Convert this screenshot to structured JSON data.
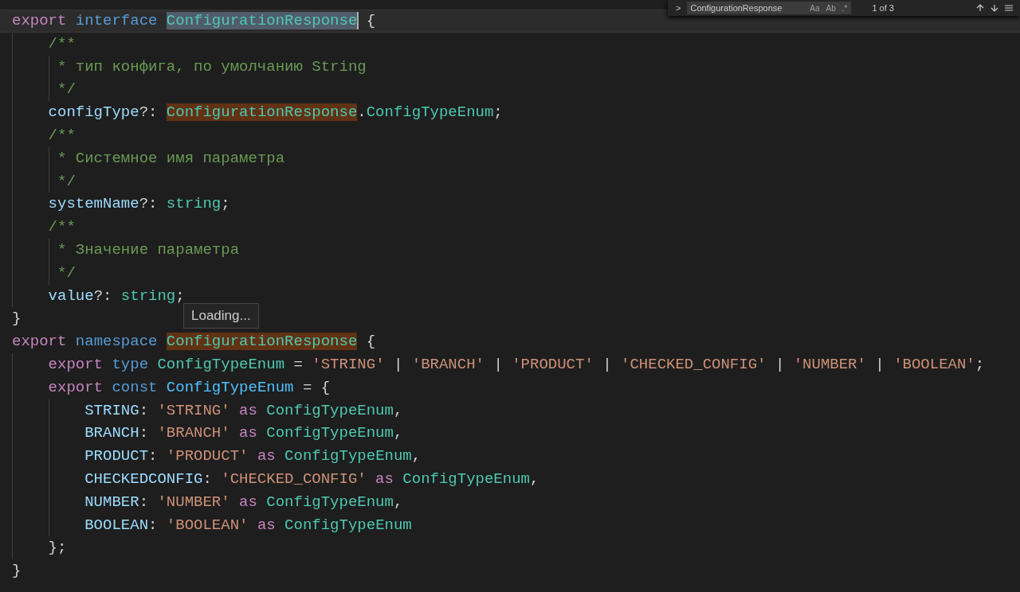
{
  "find_widget": {
    "toggle": ">",
    "query": "ConfigurationResponse",
    "options": [
      {
        "label": "Aa",
        "on": false
      },
      {
        "label": "Ab",
        "on": false
      },
      {
        "label": ".*",
        "on": false
      }
    ],
    "count": "1 of 3"
  },
  "editor": {
    "lines": [
      {
        "current": true,
        "tokens": [
          {
            "kind": "keyword",
            "t": "export"
          },
          {
            "kind": "storage",
            "t": " interface"
          },
          {
            "kind": "type",
            "t": " ConfigurationResponse",
            "match": true,
            "active": true,
            "cursor": true
          },
          {
            "kind": "punct",
            "t": " {"
          }
        ]
      },
      {
        "tokens": [
          {
            "kind": "comment",
            "t": "    /**"
          }
        ]
      },
      {
        "tokens": [
          {
            "kind": "comment",
            "t": "     * тип конфига, по умолчанию String"
          }
        ]
      },
      {
        "tokens": [
          {
            "kind": "comment",
            "t": "     */"
          }
        ]
      },
      {
        "tokens": [
          {
            "kind": "property",
            "t": "    configType"
          },
          {
            "kind": "punct",
            "t": "?:"
          },
          {
            "kind": "type",
            "t": " ConfigurationResponse",
            "match": true,
            "active": false
          },
          {
            "kind": "punct",
            "t": "."
          },
          {
            "kind": "type",
            "t": "ConfigTypeEnum"
          },
          {
            "kind": "punct",
            "t": ";"
          }
        ]
      },
      {
        "tokens": [
          {
            "kind": "comment",
            "t": "    /**"
          }
        ]
      },
      {
        "tokens": [
          {
            "kind": "comment",
            "t": "     * Системное имя параметра"
          }
        ]
      },
      {
        "tokens": [
          {
            "kind": "comment",
            "t": "     */"
          }
        ]
      },
      {
        "tokens": [
          {
            "kind": "property",
            "t": "    systemName"
          },
          {
            "kind": "punct",
            "t": "?:"
          },
          {
            "kind": "type",
            "t": " string"
          },
          {
            "kind": "punct",
            "t": ";"
          }
        ]
      },
      {
        "tokens": [
          {
            "kind": "comment",
            "t": "    /**"
          }
        ]
      },
      {
        "tokens": [
          {
            "kind": "comment",
            "t": "     * Значение параметра"
          }
        ]
      },
      {
        "tokens": [
          {
            "kind": "comment",
            "t": "     */"
          }
        ]
      },
      {
        "tokens": [
          {
            "kind": "property",
            "t": "    value"
          },
          {
            "kind": "punct",
            "t": "?:"
          },
          {
            "kind": "type",
            "t": " string"
          },
          {
            "kind": "punct",
            "t": ";"
          }
        ]
      },
      {
        "tokens": [
          {
            "kind": "punct",
            "t": "}"
          }
        ]
      },
      {
        "tokens": [
          {
            "kind": "keyword",
            "t": "export"
          },
          {
            "kind": "storage",
            "t": " namespace"
          },
          {
            "kind": "type",
            "t": " ConfigurationResponse",
            "match": true,
            "active": false
          },
          {
            "kind": "punct",
            "t": " {"
          }
        ]
      },
      {
        "tokens": [
          {
            "kind": "keyword",
            "t": "    export"
          },
          {
            "kind": "storage",
            "t": " type"
          },
          {
            "kind": "type",
            "t": " ConfigTypeEnum"
          },
          {
            "kind": "punct",
            "t": " ="
          },
          {
            "kind": "string",
            "t": " 'STRING'"
          },
          {
            "kind": "punct",
            "t": " |"
          },
          {
            "kind": "string",
            "t": " 'BRANCH'"
          },
          {
            "kind": "punct",
            "t": " |"
          },
          {
            "kind": "string",
            "t": " 'PRODUCT'"
          },
          {
            "kind": "punct",
            "t": " |"
          },
          {
            "kind": "string",
            "t": " 'CHECKED_CONFIG'"
          },
          {
            "kind": "punct",
            "t": " |"
          },
          {
            "kind": "string",
            "t": " 'NUMBER'"
          },
          {
            "kind": "punct",
            "t": " |"
          },
          {
            "kind": "string",
            "t": " 'BOOLEAN'"
          },
          {
            "kind": "punct",
            "t": ";"
          }
        ]
      },
      {
        "tokens": [
          {
            "kind": "keyword",
            "t": "    export"
          },
          {
            "kind": "storage",
            "t": " const"
          },
          {
            "kind": "const",
            "t": " ConfigTypeEnum"
          },
          {
            "kind": "punct",
            "t": " = {"
          }
        ]
      },
      {
        "tokens": [
          {
            "kind": "property",
            "t": "        STRING"
          },
          {
            "kind": "punct",
            "t": ":"
          },
          {
            "kind": "string",
            "t": " 'STRING'"
          },
          {
            "kind": "keyword",
            "t": " as"
          },
          {
            "kind": "type",
            "t": " ConfigTypeEnum"
          },
          {
            "kind": "punct",
            "t": ","
          }
        ]
      },
      {
        "tokens": [
          {
            "kind": "property",
            "t": "        BRANCH"
          },
          {
            "kind": "punct",
            "t": ":"
          },
          {
            "kind": "string",
            "t": " 'BRANCH'"
          },
          {
            "kind": "keyword",
            "t": " as"
          },
          {
            "kind": "type",
            "t": " ConfigTypeEnum"
          },
          {
            "kind": "punct",
            "t": ","
          }
        ]
      },
      {
        "tokens": [
          {
            "kind": "property",
            "t": "        PRODUCT"
          },
          {
            "kind": "punct",
            "t": ":"
          },
          {
            "kind": "string",
            "t": " 'PRODUCT'"
          },
          {
            "kind": "keyword",
            "t": " as"
          },
          {
            "kind": "type",
            "t": " ConfigTypeEnum"
          },
          {
            "kind": "punct",
            "t": ","
          }
        ]
      },
      {
        "tokens": [
          {
            "kind": "property",
            "t": "        CHECKEDCONFIG"
          },
          {
            "kind": "punct",
            "t": ":"
          },
          {
            "kind": "string",
            "t": " 'CHECKED_CONFIG'"
          },
          {
            "kind": "keyword",
            "t": " as"
          },
          {
            "kind": "type",
            "t": " ConfigTypeEnum"
          },
          {
            "kind": "punct",
            "t": ","
          }
        ]
      },
      {
        "tokens": [
          {
            "kind": "property",
            "t": "        NUMBER"
          },
          {
            "kind": "punct",
            "t": ":"
          },
          {
            "kind": "string",
            "t": " 'NUMBER'"
          },
          {
            "kind": "keyword",
            "t": " as"
          },
          {
            "kind": "type",
            "t": " ConfigTypeEnum"
          },
          {
            "kind": "punct",
            "t": ","
          }
        ]
      },
      {
        "tokens": [
          {
            "kind": "property",
            "t": "        BOOLEAN"
          },
          {
            "kind": "punct",
            "t": ":"
          },
          {
            "kind": "string",
            "t": " 'BOOLEAN'"
          },
          {
            "kind": "keyword",
            "t": " as"
          },
          {
            "kind": "type",
            "t": " ConfigTypeEnum"
          }
        ]
      },
      {
        "tokens": [
          {
            "kind": "punct",
            "t": "    };"
          }
        ]
      },
      {
        "tokens": [
          {
            "kind": "punct",
            "t": "}"
          }
        ]
      }
    ]
  },
  "hover_tooltip": {
    "text": "Loading..."
  }
}
